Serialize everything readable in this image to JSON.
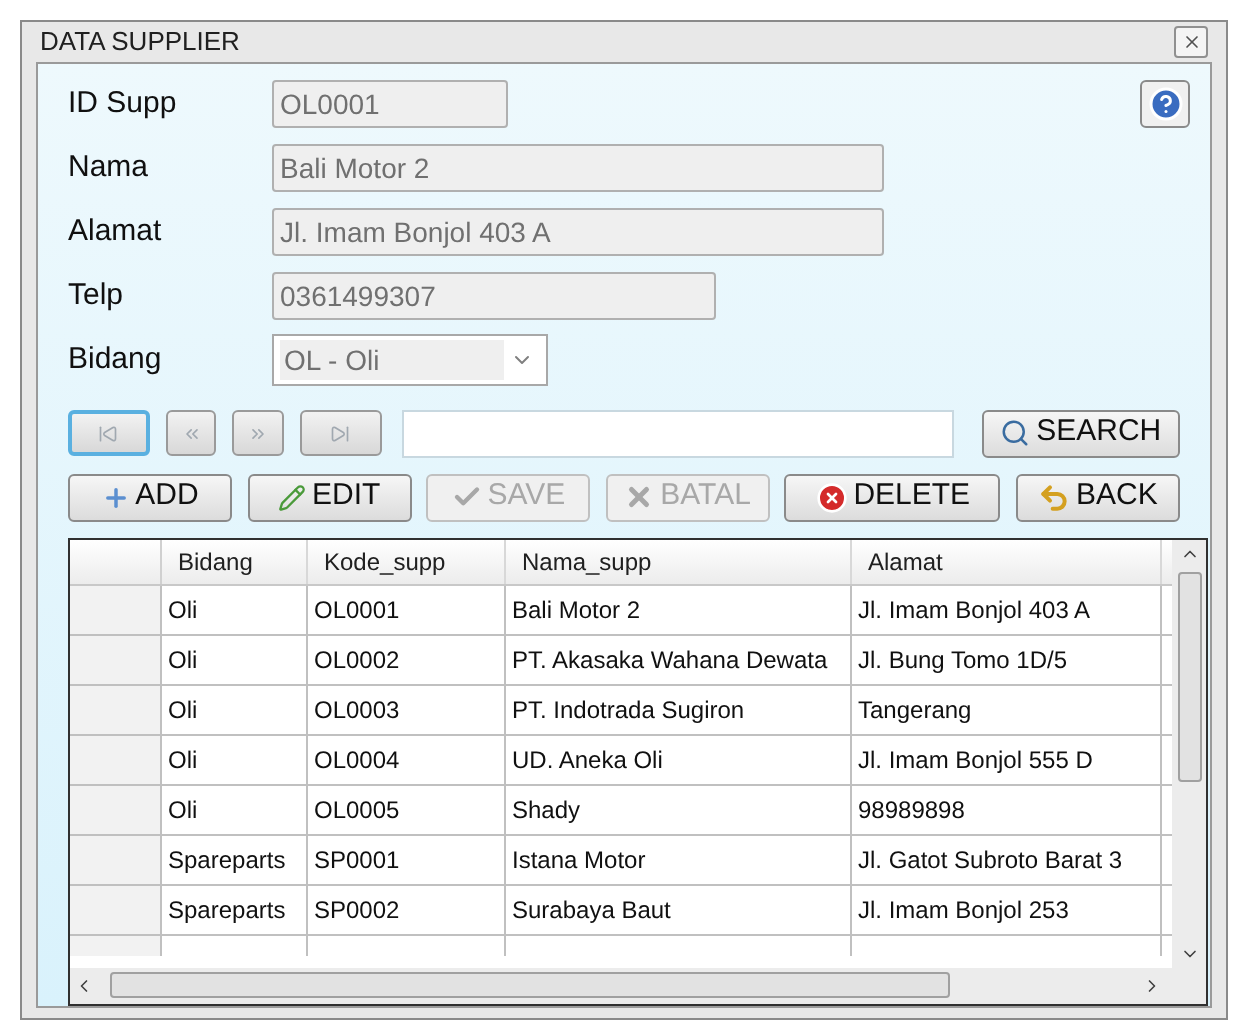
{
  "window": {
    "title": "DATA SUPPLIER"
  },
  "form": [
    {
      "label": "ID Supp",
      "value": "OL0001",
      "kind": "text"
    },
    {
      "label": "Nama",
      "value": "Bali Motor 2",
      "kind": "text"
    },
    {
      "label": "Alamat",
      "value": "Jl. Imam Bonjol 403 A",
      "kind": "text"
    },
    {
      "label": "Telp",
      "value": "0361499307",
      "kind": "text"
    },
    {
      "label": "Bidang",
      "value": "OL - Oli",
      "kind": "dropdown"
    }
  ],
  "navigation": [
    {
      "kind": "first",
      "focused": true
    },
    {
      "kind": "previous",
      "focused": false
    },
    {
      "kind": "next",
      "focused": false
    },
    {
      "kind": "last",
      "focused": false
    }
  ],
  "search_button": "SEARCH",
  "actions": [
    {
      "kind": "add",
      "label": "ADD",
      "disabled": false
    },
    {
      "kind": "edit",
      "label": "EDIT",
      "disabled": false
    },
    {
      "kind": "save",
      "label": "SAVE",
      "disabled": true
    },
    {
      "kind": "cancel",
      "label": "BATAL",
      "disabled": true
    },
    {
      "kind": "delete",
      "label": "DELETE",
      "disabled": false
    },
    {
      "kind": "back",
      "label": "BACK",
      "disabled": false
    }
  ],
  "table": {
    "columns": [
      "Bidang",
      "Kode_supp",
      "Nama_supp",
      "Alamat"
    ],
    "rows": [
      [
        "Oli",
        "OL0001",
        "Bali Motor 2",
        "Jl. Imam Bonjol 403 A"
      ],
      [
        "Oli",
        "OL0002",
        "PT. Akasaka Wahana Dewata",
        "Jl. Bung Tomo 1D/5"
      ],
      [
        "Oli",
        "OL0003",
        "PT. Indotrada Sugiron",
        "Tangerang"
      ],
      [
        "Oli",
        "OL0004",
        "UD. Aneka Oli",
        "Jl. Imam Bonjol 555 D"
      ],
      [
        "Oli",
        "OL0005",
        "Shady",
        "98989898"
      ],
      [
        "Spareparts",
        "SP0001",
        "Istana Motor",
        "Jl. Gatot Subroto Barat 3"
      ],
      [
        "Spareparts",
        "SP0002",
        "Surabaya Baut",
        "Jl. Imam Bonjol 253"
      ]
    ]
  }
}
